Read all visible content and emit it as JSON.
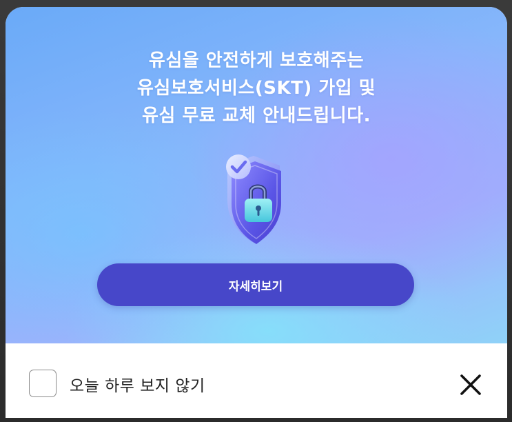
{
  "popup": {
    "headline_lines": [
      "유심을 안전하게 보호해주는",
      "유심보호서비스(SKT) 가입 및",
      "유심 무료 교체 안내드립니다."
    ],
    "illustration": {
      "icon": "shield-lock-icon"
    },
    "detail_button_label": "자세히보기"
  },
  "footer": {
    "dont_show_today_label": "오늘 하루 보지 않기",
    "dont_show_today_checked": false,
    "close_icon": "close-icon"
  },
  "colors": {
    "button": "#4747c9",
    "gradient_blue": "#6aaaf8",
    "gradient_lavender": "#a8a0ff",
    "gradient_cyan": "#82e6fa"
  }
}
